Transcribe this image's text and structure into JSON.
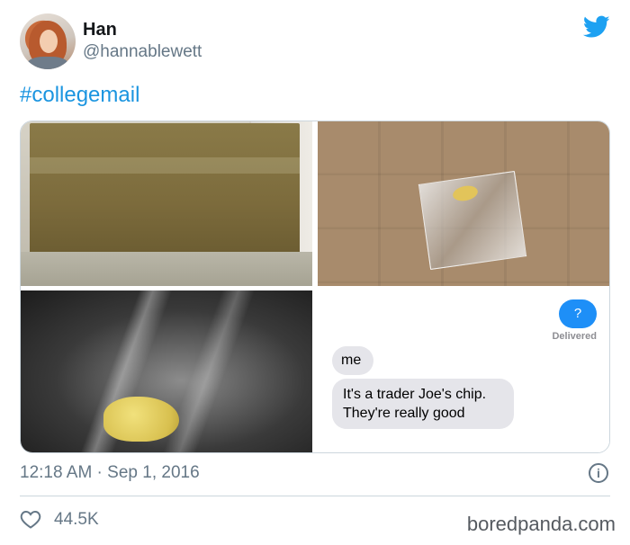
{
  "tweet": {
    "author_name": "Han",
    "author_handle": "@hannablewett",
    "hashtag": "#collegemail",
    "timestamp": "12:18 AM · Sep 1, 2016",
    "likes": "44.5K",
    "info_glyph": "i"
  },
  "message_screenshot": {
    "sent_bubble": "?",
    "status": "Delivered",
    "reply_1": "me",
    "reply_2": "It's a trader Joe's chip. They're really good"
  },
  "icons": {
    "brand": "twitter-bird-icon",
    "like": "heart-icon",
    "info": "info-icon"
  },
  "colors": {
    "link": "#1b95e0",
    "bird": "#1da1f2",
    "imessage_blue": "#1e8ff7",
    "secondary_text": "#657786"
  },
  "watermark": "boredpanda.com"
}
